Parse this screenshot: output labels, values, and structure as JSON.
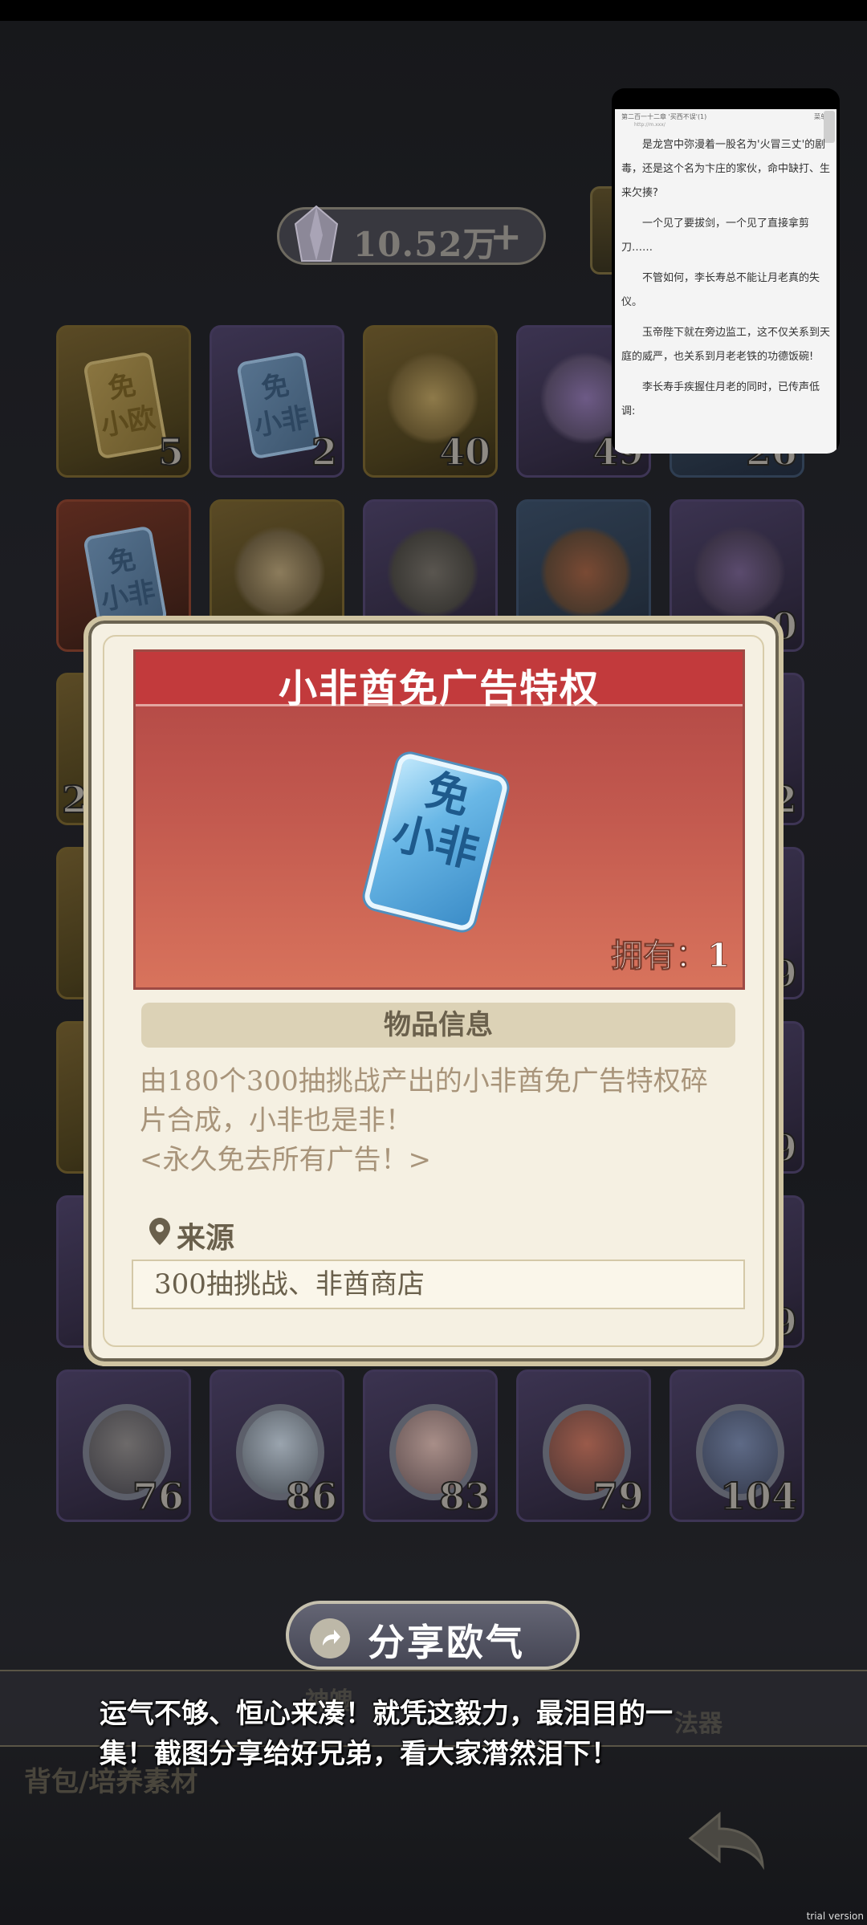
{
  "currency": {
    "value": "10.52万",
    "plus": "+"
  },
  "items_row1": [
    {
      "count": "5",
      "glyph": "免\n小欧"
    },
    {
      "count": "2",
      "glyph": "免\n小非"
    },
    {
      "count": "40"
    },
    {
      "count": "49"
    },
    {
      "count": "26"
    }
  ],
  "items_row2": [
    {
      "glyph": "免\n小非"
    },
    {},
    {},
    {},
    {
      "count": "0"
    }
  ],
  "items_row_partial_left": [
    "2"
  ],
  "items_row_partial_right": [
    "2",
    "9",
    "9",
    "9"
  ],
  "items_row_last": [
    {
      "count": "76"
    },
    {
      "count": "86"
    },
    {
      "count": "83"
    },
    {
      "count": "79"
    },
    {
      "count": "104"
    }
  ],
  "reader": {
    "header": "第二百一十二章 '买西不误'(1)",
    "menu": "菜单",
    "url": "http://m.xxx/",
    "paragraphs": [
      "是龙宫中弥漫着一股名为'火冒三丈'的剧毒，还是这个名为卞庄的家伙，命中缺打、生来欠揍?",
      "一个见了要拔剑，一个见了直接拿剪刀……",
      "不管如何，李长寿总不能让月老真的失仪。",
      "玉帝陛下就在旁边监工，这不仅关系到天庭的威严，也关系到月老老铁的功德饭碗!",
      "李长寿手疾握住月老的同时，已传声低调:"
    ]
  },
  "modal": {
    "title": "小非酋免广告特权",
    "ticket_text": "免\n小非",
    "owned": "拥有：1",
    "info_header": "物品信息",
    "description_line1": "由180个300抽挑战产出的小非酋免广告特权碎",
    "description_line2": "片合成，小非也是非！",
    "description_line3": "<永久免去所有广告！>",
    "source_label": "来源",
    "source_value": "300抽挑战、非酋商店"
  },
  "share_button": {
    "label": "分享欧气"
  },
  "bottom_bar": {
    "tab_ghost_1": "神魄",
    "tab_ghost_2": "法器"
  },
  "caption": {
    "line1": "运气不够、恒心来凑！就凭这毅力，最泪目的一",
    "line2": "集！截图分享给好兄弟，看大家潸然泪下！"
  },
  "breadcrumb": "背包/培养素材",
  "watermark": "trial version",
  "colors": {
    "modal_bg": "#f5f0e2",
    "banner_red": "#c23a3c",
    "text_muted": "#a8947a"
  }
}
